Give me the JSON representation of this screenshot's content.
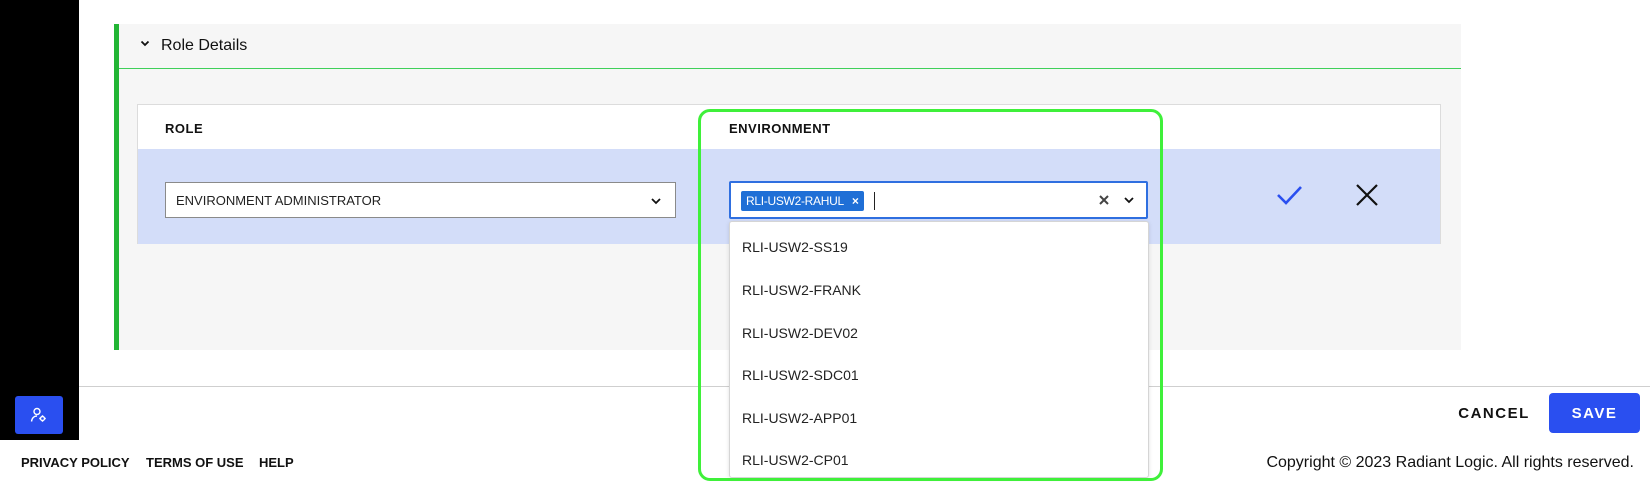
{
  "section": {
    "title": "Role Details",
    "accent": "#22b534"
  },
  "table": {
    "headers": {
      "role": "ROLE",
      "environment": "ENVIRONMENT"
    },
    "row": {
      "role_value": "ENVIRONMENT ADMINISTRATOR",
      "environment_chip": "RLI-USW2-RAHUL",
      "environment_input_value": ""
    }
  },
  "dropdown": {
    "options": [
      "RLI-USW2-SS19",
      "RLI-USW2-FRANK",
      "RLI-USW2-DEV02",
      "RLI-USW2-SDC01",
      "RLI-USW2-APP01",
      "RLI-USW2-CP01"
    ]
  },
  "actions": {
    "cancel_label": "CANCEL",
    "save_label": "SAVE"
  },
  "footer": {
    "links": [
      "PRIVACY POLICY",
      "TERMS OF USE",
      "HELP"
    ],
    "copyright": "Copyright © 2023 Radiant Logic. All rights reserved."
  },
  "colors": {
    "primary": "#2a4ff0",
    "chip": "#1f6fd6",
    "row_selected": "#d3ddf9",
    "highlight": "#3ff03a"
  },
  "icons": {
    "section_toggle": "chevron-down-icon",
    "role_caret": "chevron-down-icon",
    "chip_remove": "close-icon",
    "clear": "close-icon",
    "env_caret": "chevron-down-icon",
    "confirm": "check-icon",
    "cancel_row": "close-icon",
    "rail_button": "user-settings-icon"
  }
}
